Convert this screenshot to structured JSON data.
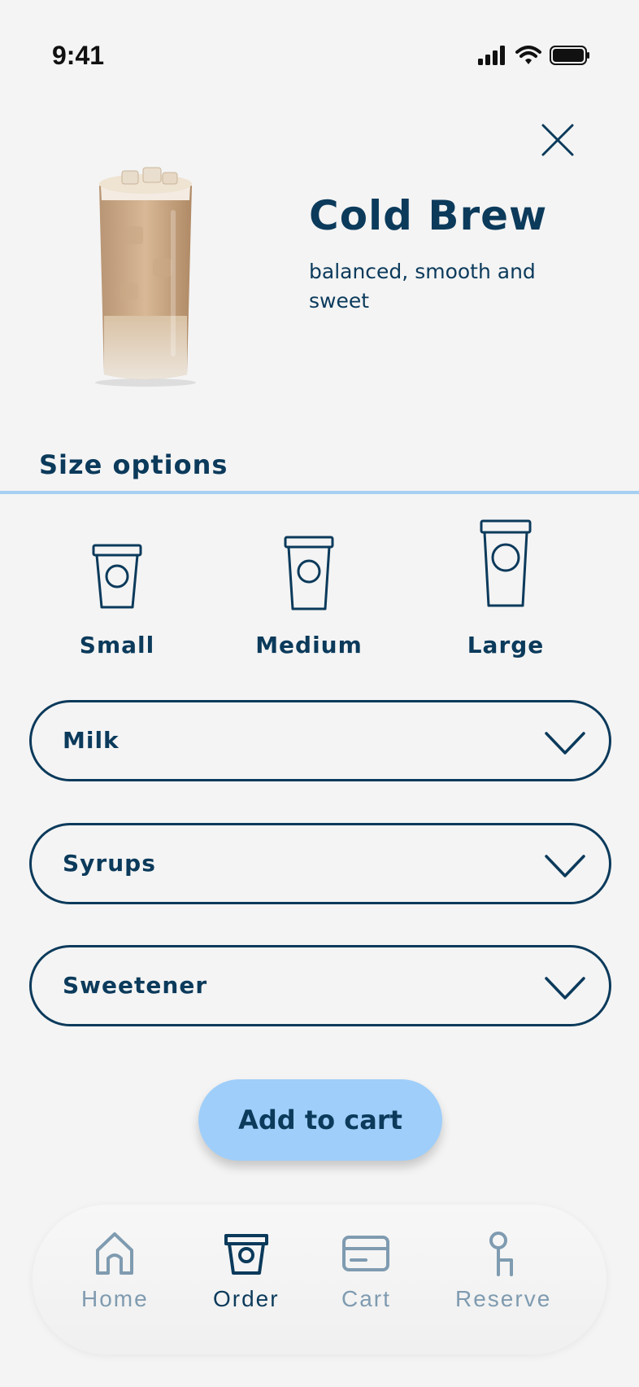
{
  "status_bar": {
    "time": "9:41"
  },
  "product": {
    "name": "Cold Brew",
    "description": "balanced, smooth and sweet"
  },
  "size_section": {
    "title": "Size options",
    "options": [
      {
        "label": "Small"
      },
      {
        "label": "Medium"
      },
      {
        "label": "Large"
      }
    ]
  },
  "dropdowns": [
    {
      "label": "Milk"
    },
    {
      "label": "Syrups"
    },
    {
      "label": "Sweetener"
    }
  ],
  "add_to_cart_label": "Add to cart",
  "bottom_nav": {
    "items": [
      {
        "label": "Home",
        "icon": "home-icon",
        "active": false
      },
      {
        "label": "Order",
        "icon": "cup-icon",
        "active": true
      },
      {
        "label": "Cart",
        "icon": "card-icon",
        "active": false
      },
      {
        "label": "Reserve",
        "icon": "reserve-icon",
        "active": false
      }
    ]
  },
  "colors": {
    "primary": "#0b3a5b",
    "accent": "#9fcefa",
    "divider": "#a6cff2",
    "inactive": "#7f9bb0",
    "background": "#f4f4f4"
  }
}
